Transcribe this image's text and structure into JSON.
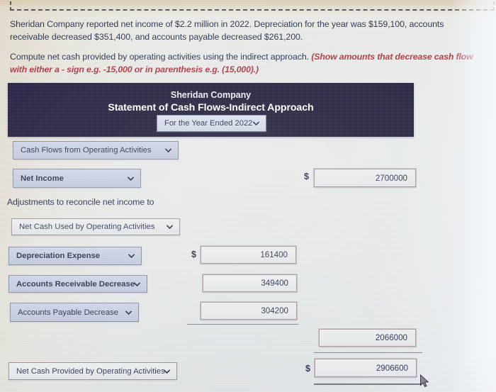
{
  "question": {
    "paragraph_1": "Sheridan Company reported net income of $2.2 million in 2022. Depreciation for the year was $159,100, accounts receivable decreased $351,400, and accounts payable decreased $261,200.",
    "paragraph_2_main": "Compute net cash provided by operating activities using the indirect approach.",
    "paragraph_2_emphasis": "(Show amounts that decrease cash flow with either a - sign e.g. -15,000 or in parenthesis e.g. (15,000).)"
  },
  "statement": {
    "company_name": "Sheridan Company",
    "title": "Statement of Cash Flows-Indirect Approach",
    "period_select": {
      "value": "For the Year Ended 2022",
      "icon": "chevron-down-icon"
    },
    "header_bg": "#120f2e"
  },
  "rows": {
    "section_header": {
      "select_value": "Cash Flows from Operating Activities",
      "icon": "chevron-down-icon"
    },
    "net_income": {
      "select_value": "Net Income",
      "currency_symbol": "$",
      "amount": "2700000"
    },
    "adjustments_label": "Adjustments to reconcile net income to",
    "adjustments_subheader": {
      "select_value": "Net Cash Used by Operating Activities",
      "icon": "chevron-down-icon"
    },
    "depreciation": {
      "select_value": "Depreciation Expense",
      "currency_symbol": "$",
      "amount": "161400"
    },
    "accounts_receivable": {
      "select_value": "Accounts Receivable Decrease",
      "amount": "349400"
    },
    "accounts_payable": {
      "select_value": "Accounts Payable Decrease",
      "amount": "304200"
    },
    "subtotal": {
      "amount": "2066000"
    },
    "total": {
      "select_value": "Net Cash Provided by Operating Activities",
      "currency_symbol": "$",
      "amount": "2906600"
    }
  },
  "colors": {
    "header_navy": "#120f2e",
    "select_blue": "#c6cfe2",
    "input_gray": "#e9ebee",
    "text_navy": "#1c2340",
    "emphasis_red": "#a62a33"
  },
  "cursor": {
    "icon": "mouse-pointer-icon"
  }
}
